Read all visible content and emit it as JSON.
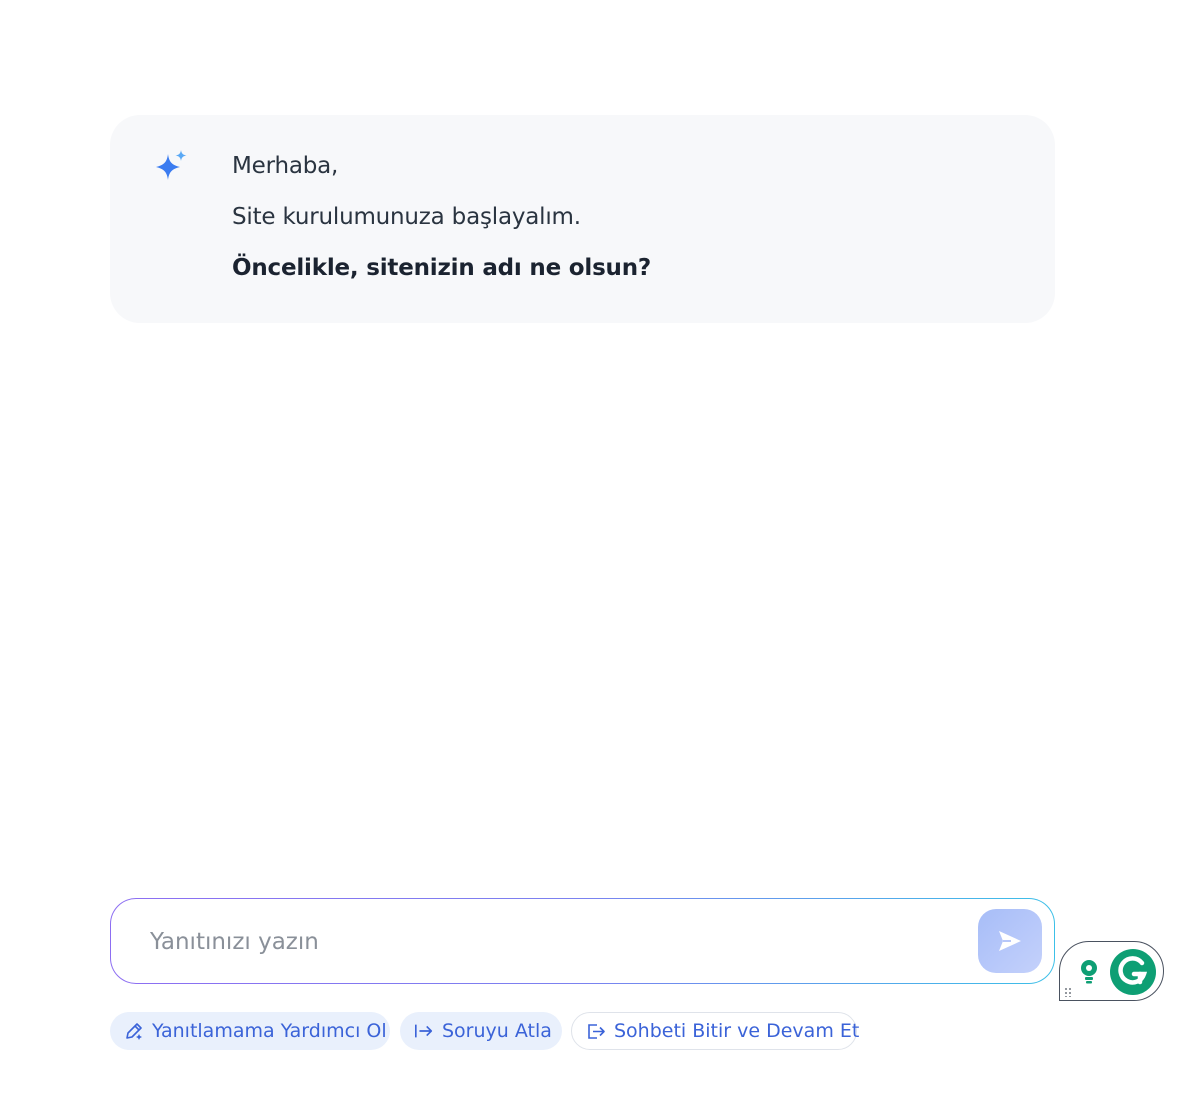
{
  "assistant_message": {
    "greeting": "Merhaba,",
    "intro": "Site kurulumunuza başlayalım.",
    "question": "Öncelikle, sitenizin adı ne olsun?",
    "icon": "sparkle-icon",
    "icon_color": "#3b82f6"
  },
  "composer": {
    "placeholder": "Yanıtınızı yazın",
    "value": "",
    "send_icon": "send-icon"
  },
  "actions": [
    {
      "label": "Yanıtlamama Yardımcı Ol",
      "icon": "pencil-sparkle-icon"
    },
    {
      "label": "Soruyu Atla",
      "icon": "skip-arrow-icon"
    },
    {
      "label": "Sohbeti Bitir ve Devam Et",
      "icon": "exit-icon"
    }
  ],
  "colors": {
    "accent": "#3b63d8",
    "chip_bg": "#e9f0fc",
    "card_bg": "#f7f8fa",
    "grammarly_green": "#0e9f74"
  }
}
